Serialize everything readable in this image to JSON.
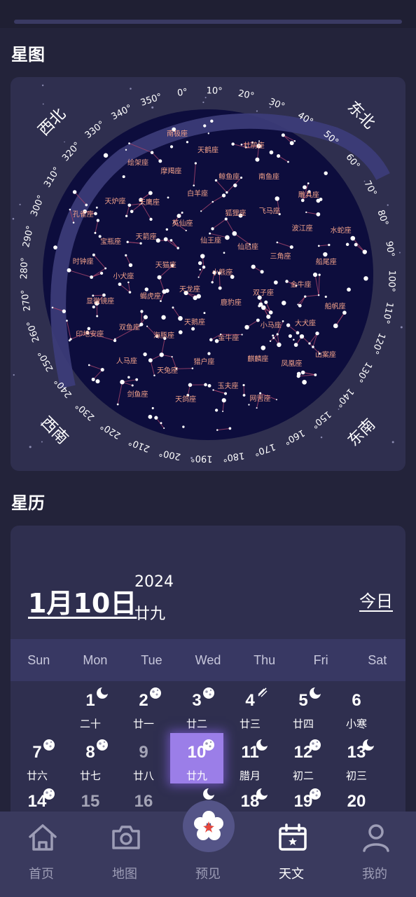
{
  "sections": {
    "starmap_title": "星图",
    "calendar_title": "星历"
  },
  "starmap": {
    "directions": [
      "西北",
      "东北",
      "西南",
      "东南"
    ],
    "azimuth_labels": [
      "0°",
      "10°",
      "20°",
      "30°",
      "40°",
      "50°",
      "60°",
      "70°",
      "80°",
      "90°",
      "100°",
      "110°",
      "120°",
      "130°",
      "140°",
      "150°",
      "160°",
      "170°",
      "180°",
      "190°",
      "200°",
      "210°",
      "220°",
      "230°",
      "240°",
      "250°",
      "260°",
      "270°",
      "280°",
      "290°",
      "300°",
      "310°",
      "320°",
      "330°",
      "340°",
      "350°"
    ],
    "constellations": [
      "小熊座",
      "天龙座",
      "仙王座",
      "鹿豹座",
      "天猫座",
      "仙后座",
      "天鹅座",
      "英仙座",
      "双子座",
      "蝎虎座",
      "狐狸座",
      "金牛座",
      "天箭座",
      "三角座",
      "海豚座",
      "白羊座",
      "小马座",
      "小犬座",
      "飞马座",
      "猎户座",
      "天鹰座",
      "金牛座",
      "双鱼座",
      "鲸鱼座",
      "麒麟座",
      "宝瓶座",
      "波江座",
      "天兔座",
      "摩羯座",
      "大犬座",
      "显微镜座",
      "南鱼座",
      "玉夫座",
      "天炉座",
      "船尾座",
      "人马座",
      "天鹤座",
      "凤凰座",
      "时钟座",
      "雕具座",
      "天鸽座",
      "绘架座",
      "船帆座",
      "印地安座",
      "杜鹃座",
      "网罟座",
      "孔雀座",
      "水蛇座",
      "剑鱼座",
      "南极座",
      "山案座"
    ]
  },
  "calendar": {
    "date_main": "1月10日",
    "year": "2024",
    "lunar": "廿九",
    "today_label": "今日",
    "weekdays": [
      "Sun",
      "Mon",
      "Tue",
      "Wed",
      "Thu",
      "Fri",
      "Sat"
    ],
    "days": [
      {
        "day": "1",
        "lunar": "二十",
        "phase": "crescent",
        "col": 1,
        "row": 0
      },
      {
        "day": "2",
        "lunar": "廿一",
        "phase": "moon",
        "col": 2,
        "row": 0
      },
      {
        "day": "3",
        "lunar": "廿二",
        "phase": "moon",
        "col": 3,
        "row": 0
      },
      {
        "day": "4",
        "lunar": "廿三",
        "phase": "meteor",
        "col": 4,
        "row": 0
      },
      {
        "day": "5",
        "lunar": "廿四",
        "phase": "crescent",
        "col": 5,
        "row": 0
      },
      {
        "day": "6",
        "lunar": "小寒",
        "phase": "",
        "col": 6,
        "row": 0
      },
      {
        "day": "7",
        "lunar": "廿六",
        "phase": "moon",
        "col": 0,
        "row": 1
      },
      {
        "day": "8",
        "lunar": "廿七",
        "phase": "moon",
        "col": 1,
        "row": 1
      },
      {
        "day": "9",
        "lunar": "廿八",
        "phase": "",
        "col": 2,
        "row": 1,
        "dim": true
      },
      {
        "day": "10",
        "lunar": "廿九",
        "phase": "moon",
        "col": 3,
        "row": 1,
        "selected": true
      },
      {
        "day": "11",
        "lunar": "腊月",
        "phase": "crescent",
        "col": 4,
        "row": 1
      },
      {
        "day": "12",
        "lunar": "初二",
        "phase": "moon",
        "col": 5,
        "row": 1
      },
      {
        "day": "13",
        "lunar": "初三",
        "phase": "crescent",
        "col": 6,
        "row": 1
      },
      {
        "day": "14",
        "lunar": "",
        "phase": "moon",
        "col": 0,
        "row": 2
      },
      {
        "day": "15",
        "lunar": "",
        "phase": "",
        "col": 1,
        "row": 2,
        "dim": true
      },
      {
        "day": "16",
        "lunar": "",
        "phase": "",
        "col": 2,
        "row": 2,
        "dim": true
      },
      {
        "day": "",
        "lunar": "",
        "phase": "crescent",
        "col": 3,
        "row": 2
      },
      {
        "day": "18",
        "lunar": "",
        "phase": "crescent",
        "col": 4,
        "row": 2
      },
      {
        "day": "19",
        "lunar": "",
        "phase": "moon",
        "col": 5,
        "row": 2
      },
      {
        "day": "20",
        "lunar": "",
        "phase": "",
        "col": 6,
        "row": 2
      }
    ]
  },
  "tabs": [
    {
      "label": "首页",
      "icon": "home-icon",
      "active": false
    },
    {
      "label": "地图",
      "icon": "camera-icon",
      "active": false
    },
    {
      "label": "预见",
      "icon": "flower-icon",
      "active": false
    },
    {
      "label": "天文",
      "icon": "calendar-icon",
      "active": true
    },
    {
      "label": "我的",
      "icon": "person-icon",
      "active": false
    }
  ],
  "colors": {
    "background": "#23233a",
    "card": "#2f2f4f",
    "selected_day": "#9b7ee8",
    "constellation_label": "#f0a089",
    "tabbar": "#3a3a5e"
  }
}
